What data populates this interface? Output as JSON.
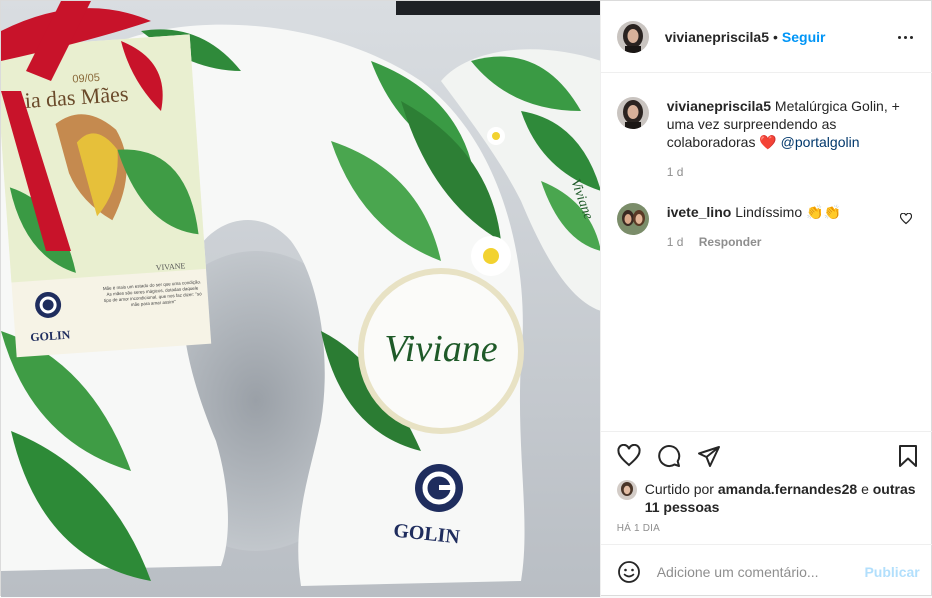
{
  "author": {
    "username": "vivianepriscila5",
    "follow_label": "Seguir",
    "dot": "•"
  },
  "caption": {
    "username": "vivianepriscila5",
    "text": "Metalúrgica Golin, + uma vez surpreendendo as colaboradoras",
    "emoji": "❤️",
    "mention": "@portalgolin",
    "time": "1 d"
  },
  "comment": {
    "username": "ivete_lino",
    "text": "Lindíssimo",
    "emoji": "👏👏",
    "time": "1 d",
    "reply_label": "Responder"
  },
  "likes": {
    "prefix": "Curtido por",
    "user": "amanda.fernandes28",
    "conj": "e",
    "others": "outras 11 pessoas"
  },
  "timestamp": "HÁ 1 DIA",
  "add_comment": {
    "placeholder": "Adicione um comentário...",
    "publish_label": "Publicar"
  },
  "photo": {
    "card_date": "09/05",
    "card_title": "Dia das Mães",
    "card_name": "VIVANE",
    "card_text": "Mãe é mais um estado do ser que uma condição. As mães são seres mágicos, dotadas daquele tipo de amor incondicional, que nos faz dizer: \"só mãe para amar assim\"",
    "card_brand": "GOLIN",
    "pillow_name": "Viviane",
    "pillow_brand": "GOLIN",
    "side_name": "Viviane"
  },
  "icons": [
    "more-icon",
    "heart-icon",
    "comment-icon",
    "share-icon",
    "bookmark-icon",
    "emoji-icon"
  ],
  "colors": {
    "accent": "#0095f6",
    "link": "#00376b",
    "muted": "#8e8e8e",
    "publish_disabled": "#b2dffc"
  }
}
